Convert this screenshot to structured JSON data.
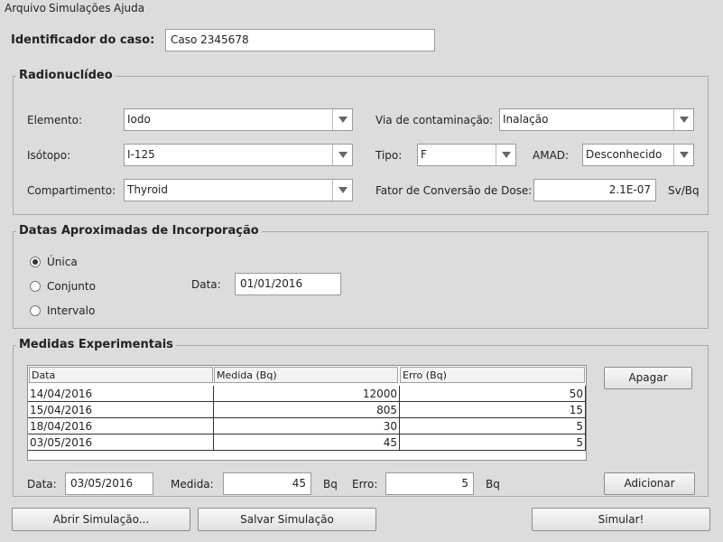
{
  "menu": {
    "items": [
      "Arquivo",
      "Simulações",
      "Ajuda"
    ]
  },
  "case": {
    "label": "Identificador do caso:",
    "value": "Caso 2345678"
  },
  "radionuclide": {
    "title": "Radionuclídeo",
    "element_label": "Elemento:",
    "element_value": "Iodo",
    "route_label": "Via de contaminação:",
    "route_value": "Inalação",
    "isotope_label": "Isótopo:",
    "isotope_value": "I-125",
    "type_label": "Tipo:",
    "type_value": "F",
    "amad_label": "AMAD:",
    "amad_value": "Desconhecido",
    "compartment_label": "Compartimento:",
    "compartment_value": "Thyroid",
    "dcf_label": "Fator de Conversão de Dose:",
    "dcf_value": "2.1E-07",
    "dcf_unit": "Sv/Bq"
  },
  "dates": {
    "title": "Datas Aproximadas de Incorporação",
    "options": [
      "Única",
      "Conjunto",
      "Intervalo"
    ],
    "selected": "Única",
    "date_label": "Data:",
    "date_value": "01/01/2016"
  },
  "measurements": {
    "title": "Medidas Experimentais",
    "columns": [
      "Data",
      "Medida (Bq)",
      "Erro (Bq)"
    ],
    "rows": [
      [
        "14/04/2016",
        "12000",
        "50"
      ],
      [
        "15/04/2016",
        "805",
        "15"
      ],
      [
        "18/04/2016",
        "30",
        "5"
      ],
      [
        "03/05/2016",
        "45",
        "5"
      ]
    ],
    "delete_label": "Apagar",
    "add_label": "Adicionar",
    "date_label": "Data:",
    "date_value": "03/05/2016",
    "measure_label": "Medida:",
    "measure_value": "45",
    "measure_unit": "Bq",
    "error_label": "Erro:",
    "error_value": "5",
    "error_unit": "Bq"
  },
  "buttons": {
    "open": "Abrir Simulação...",
    "save": "Salvar Simulação",
    "simulate": "Simular!"
  }
}
